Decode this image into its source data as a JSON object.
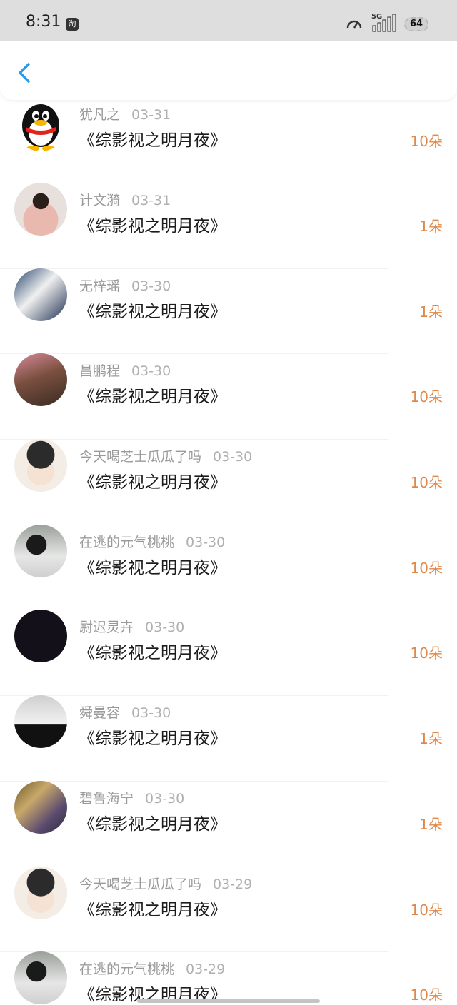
{
  "status_bar": {
    "time": "8:31",
    "app_icon": "taobao-icon",
    "network": "5G",
    "battery": "64"
  },
  "nav": {
    "back_icon": "chevron-left-icon"
  },
  "colors": {
    "accent": "#2a9be8",
    "amount": "#e0884a",
    "secondary_text": "#9a9a9a"
  },
  "items": [
    {
      "name": "犹凡之",
      "date": "03-31",
      "title": "《综影视之明月夜》",
      "amount": "10朵",
      "avatar": "qq-penguin-avatar"
    },
    {
      "name": "计文漪",
      "date": "03-31",
      "title": "《综影视之明月夜》",
      "amount": "1朵",
      "avatar": "photo-avatar"
    },
    {
      "name": "无梓瑶",
      "date": "03-30",
      "title": "《综影视之明月夜》",
      "amount": "1朵",
      "avatar": "photo-avatar"
    },
    {
      "name": "昌鹏程",
      "date": "03-30",
      "title": "《综影视之明月夜》",
      "amount": "10朵",
      "avatar": "photo-avatar"
    },
    {
      "name": "今天喝芝士瓜瓜了吗",
      "date": "03-30",
      "title": "《综影视之明月夜》",
      "amount": "10朵",
      "avatar": "cartoon-avatar"
    },
    {
      "name": "在逃的元气桃桃",
      "date": "03-30",
      "title": "《综影视之明月夜》",
      "amount": "10朵",
      "avatar": "photo-avatar"
    },
    {
      "name": "尉迟灵卉",
      "date": "03-30",
      "title": "《综影视之明月夜》",
      "amount": "10朵",
      "avatar": "dark-avatar"
    },
    {
      "name": "舜曼容",
      "date": "03-30",
      "title": "《综影视之明月夜》",
      "amount": "1朵",
      "avatar": "photo-avatar"
    },
    {
      "name": "碧鲁海宁",
      "date": "03-30",
      "title": "《综影视之明月夜》",
      "amount": "1朵",
      "avatar": "photo-avatar"
    },
    {
      "name": "今天喝芝士瓜瓜了吗",
      "date": "03-29",
      "title": "《综影视之明月夜》",
      "amount": "10朵",
      "avatar": "cartoon-avatar"
    },
    {
      "name": "在逃的元气桃桃",
      "date": "03-29",
      "title": "《综影视之明月夜》",
      "amount": "10朵",
      "avatar": "photo-avatar"
    }
  ]
}
